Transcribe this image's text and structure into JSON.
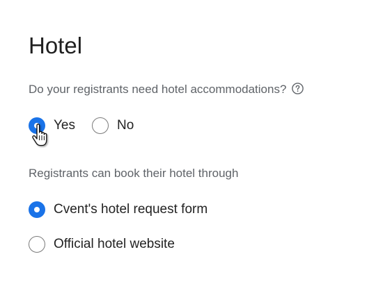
{
  "section": {
    "title": "Hotel"
  },
  "accommodations": {
    "question": "Do your registrants need hotel accommodations?",
    "options": [
      {
        "label": "Yes",
        "selected": true
      },
      {
        "label": "No",
        "selected": false
      }
    ]
  },
  "booking": {
    "heading": "Registrants can book their hotel through",
    "options": [
      {
        "label": "Cvent's hotel request form",
        "selected": true
      },
      {
        "label": "Official hotel website",
        "selected": false
      }
    ]
  },
  "colors": {
    "accent": "#1a73e8",
    "muted_text": "#5f6368",
    "text": "#222222"
  },
  "icons": {
    "help": "question-circle-icon",
    "cursor": "hand-pointer-cursor-icon"
  }
}
